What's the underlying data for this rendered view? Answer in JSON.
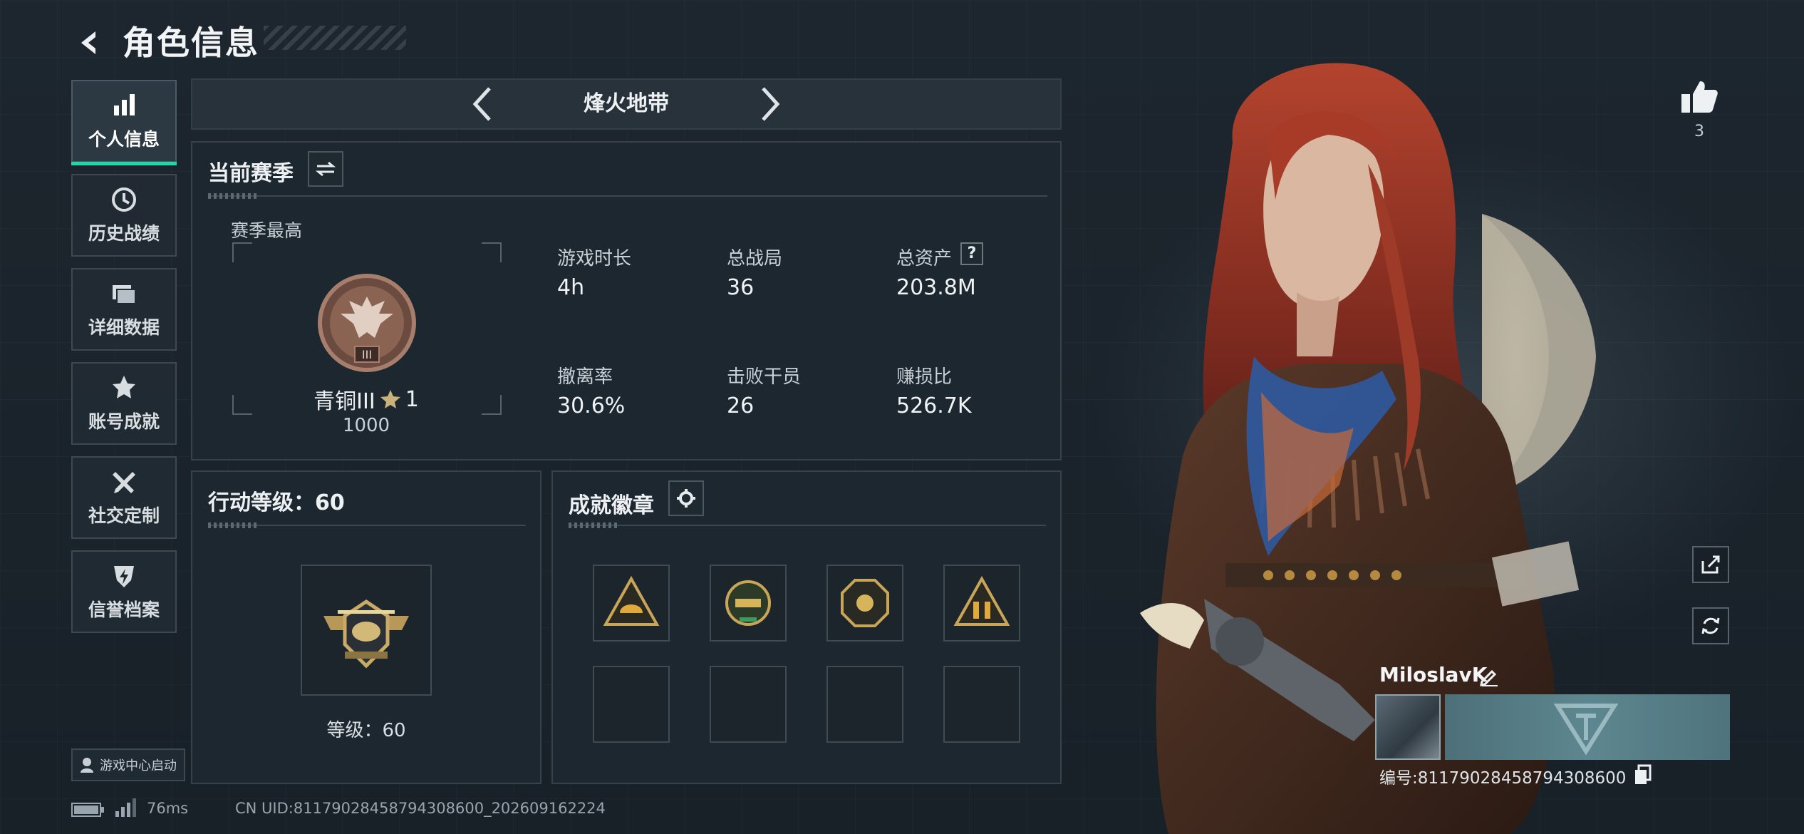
{
  "header": {
    "title": "角色信息"
  },
  "sidebar": {
    "items": [
      {
        "label": "个人信息",
        "active": true,
        "icon": "bar-chart-icon"
      },
      {
        "label": "历史战绩",
        "active": false,
        "icon": "clock-icon"
      },
      {
        "label": "详细数据",
        "active": false,
        "icon": "folders-icon"
      },
      {
        "label": "账号成就",
        "active": false,
        "icon": "achievement-star-icon"
      },
      {
        "label": "社交定制",
        "active": false,
        "icon": "tools-icon"
      },
      {
        "label": "信誉档案",
        "active": false,
        "icon": "credit-shield-icon"
      }
    ],
    "launch_label": "游戏中心启动"
  },
  "mode": {
    "name": "烽火地带"
  },
  "season": {
    "title": "当前赛季",
    "best_label": "赛季最高",
    "rank_name": "青铜III",
    "rank_stars": "1",
    "rank_points": "1000",
    "stats": [
      {
        "label": "游戏时长",
        "value": "4h"
      },
      {
        "label": "总战局",
        "value": "36"
      },
      {
        "label": "总资产",
        "value": "203.8M"
      },
      {
        "label": "撤离率",
        "value": "30.6%"
      },
      {
        "label": "击败干员",
        "value": "26"
      },
      {
        "label": "赚损比",
        "value": "526.7K"
      }
    ]
  },
  "level": {
    "title": "行动等级：60",
    "caption": "等级：60"
  },
  "badges": {
    "title": "成就徽章"
  },
  "profile": {
    "likes": "3",
    "name": "MiloslavK",
    "id_text": "编号:8117902845879430860​0"
  },
  "status_bar": {
    "ping": "76ms",
    "uid": "CN UID:81179028458794308600_202609162224"
  },
  "colors": {
    "accent": "#20d9a8",
    "background": "#1a222a",
    "panel": "#1e2830"
  }
}
